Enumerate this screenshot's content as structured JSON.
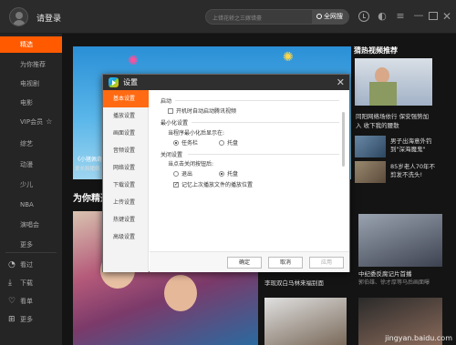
{
  "topbar": {
    "login_label": "请登录",
    "search_placeholder": "上错花轿之三嫁错豪",
    "search_button": "全网搜"
  },
  "sidebar": {
    "items": [
      {
        "label": "精选",
        "active": true
      },
      {
        "label": "为你推荐"
      },
      {
        "label": "电视剧"
      },
      {
        "label": "电影"
      },
      {
        "label": "VIP会员"
      },
      {
        "label": "综艺"
      },
      {
        "label": "动漫"
      },
      {
        "label": "少儿"
      },
      {
        "label": "NBA"
      },
      {
        "label": "演唱会"
      },
      {
        "label": "更多"
      }
    ],
    "bottom": [
      {
        "label": "看过",
        "icon": "history-icon"
      },
      {
        "label": "下载",
        "icon": "download-icon"
      },
      {
        "label": "看单",
        "icon": "heart-icon"
      },
      {
        "label": "更多",
        "icon": "grid-icon"
      }
    ]
  },
  "main": {
    "banner_caption": "《小猪佩奇",
    "banner_caption2": "爱长和猪佩",
    "section_title": "为你精选",
    "right_title": "猜热视频推荐",
    "hot_text_1": "同阳网络场依行 保安强势加",
    "hot_text_2": "入 收下我的腰散",
    "side_news": [
      {
        "text": "男子出海意外钓",
        "text2": "到\"深海魔鬼\""
      },
      {
        "text": "85岁老人70年不",
        "text2": "剪发不洗头!"
      }
    ],
    "mid_captions": [
      {
        "title": "李现双白马林来福别面",
        "sub": ""
      },
      {
        "title": "中纪委反腐记片首播",
        "sub": "郭伯雄、徐才厚等马后画面曝"
      }
    ]
  },
  "dialog": {
    "title": "设置",
    "nav": [
      {
        "label": "基本设置",
        "active": true
      },
      {
        "label": "播放设置"
      },
      {
        "label": "画面设置"
      },
      {
        "label": "音频设置"
      },
      {
        "label": "网络设置"
      },
      {
        "label": "下载设置"
      },
      {
        "label": "上传设置"
      },
      {
        "label": "热键设置"
      },
      {
        "label": "高级设置"
      }
    ],
    "startup": {
      "group": "启动",
      "autostart": "开机时自动启动腾讯视频"
    },
    "minimize": {
      "group": "最小化设置",
      "question": "当程序最小化后显示在:",
      "opt_taskbar": "任务栏",
      "opt_tray": "托盘"
    },
    "close": {
      "group": "关闭设置",
      "question": "当点击关闭按钮后:",
      "opt_exit": "退出",
      "opt_tray": "托盘",
      "remember": "记忆上次播放文件的播放位置"
    },
    "buttons": {
      "ok": "确定",
      "cancel": "取消",
      "apply": "应用"
    }
  },
  "watermark": "jingyan.baidu.com"
}
